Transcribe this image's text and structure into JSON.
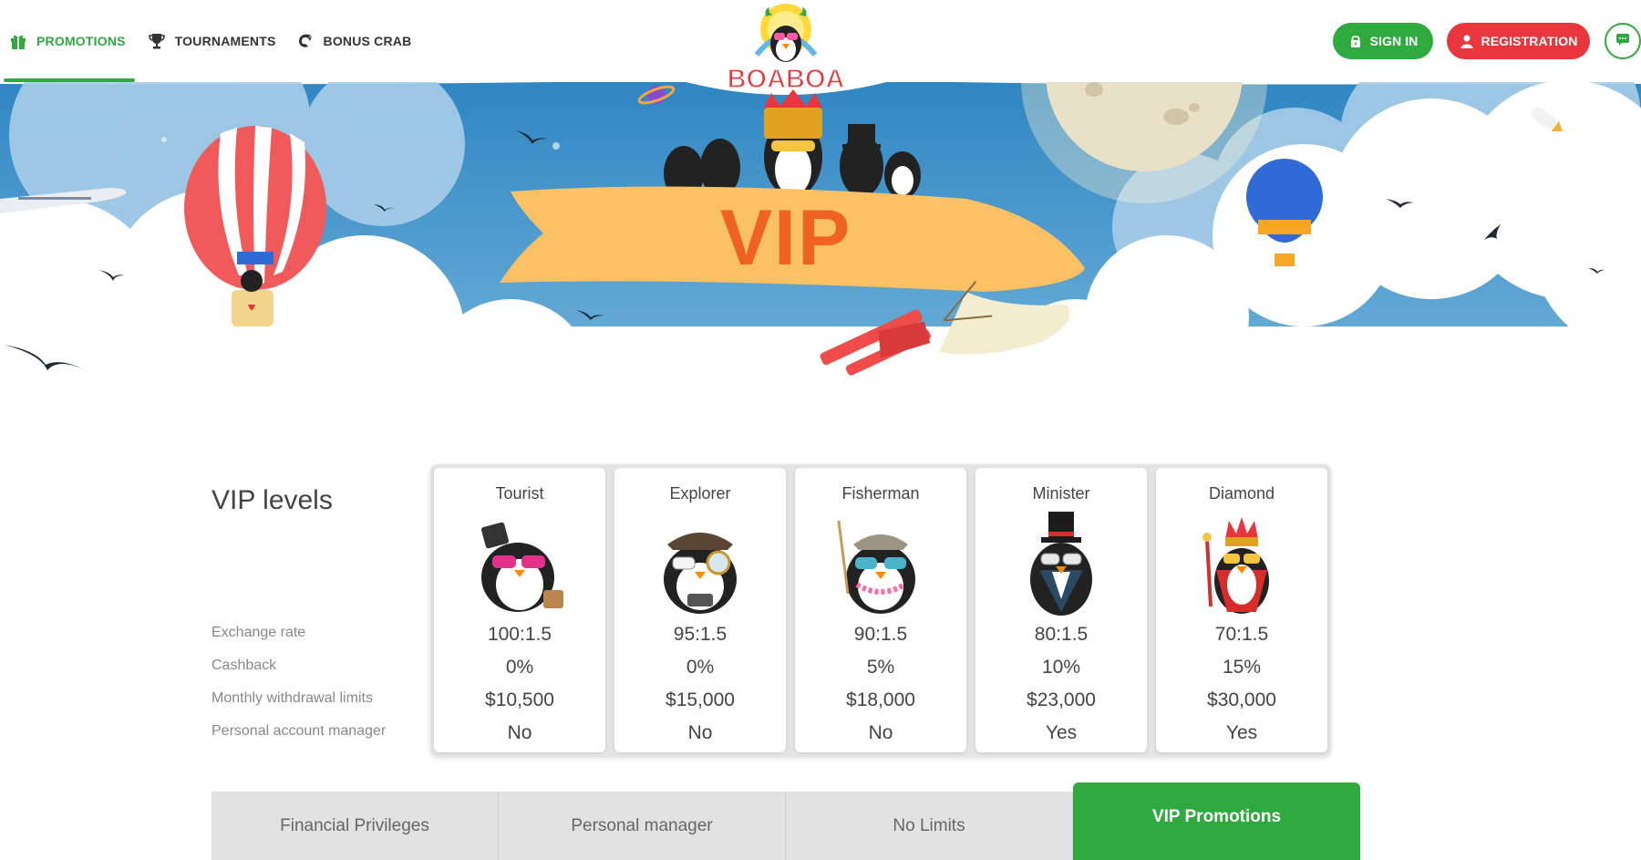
{
  "nav": {
    "items": [
      {
        "label": "PROMOTIONS",
        "icon": "gift-icon",
        "active": true
      },
      {
        "label": "TOURNAMENTS",
        "icon": "trophy-icon",
        "active": false
      },
      {
        "label": "BONUS CRAB",
        "icon": "crab-claw-icon",
        "active": false
      }
    ]
  },
  "logo": {
    "text": "BOABOA"
  },
  "auth": {
    "signin_label": "SIGN IN",
    "register_label": "REGISTRATION"
  },
  "hero": {
    "banner_text": "VIP"
  },
  "levels": {
    "title": "VIP levels",
    "rows": [
      "Exchange rate",
      "Cashback",
      "Monthly withdrawal limits",
      "Personal account manager"
    ],
    "tiers": [
      {
        "name": "Tourist",
        "exchange": "100:1.5",
        "cashback": "0%",
        "limit": "$10,500",
        "manager": "No"
      },
      {
        "name": "Explorer",
        "exchange": "95:1.5",
        "cashback": "0%",
        "limit": "$15,000",
        "manager": "No"
      },
      {
        "name": "Fisherman",
        "exchange": "90:1.5",
        "cashback": "5%",
        "limit": "$18,000",
        "manager": "No"
      },
      {
        "name": "Minister",
        "exchange": "80:1.5",
        "cashback": "10%",
        "limit": "$23,000",
        "manager": "Yes"
      },
      {
        "name": "Diamond",
        "exchange": "70:1.5",
        "cashback": "15%",
        "limit": "$30,000",
        "manager": "Yes"
      }
    ]
  },
  "tabs": [
    {
      "label": "Financial Privileges",
      "active": false
    },
    {
      "label": "Personal manager",
      "active": false
    },
    {
      "label": "No Limits",
      "active": false
    },
    {
      "label": "VIP Promotions",
      "active": true
    }
  ],
  "colors": {
    "brand_green": "#2eaa3f",
    "brand_red": "#e8363c",
    "vip_orange": "#f06223",
    "banner_yellow": "#f9c164",
    "sky_blue": "#3f93c9"
  }
}
